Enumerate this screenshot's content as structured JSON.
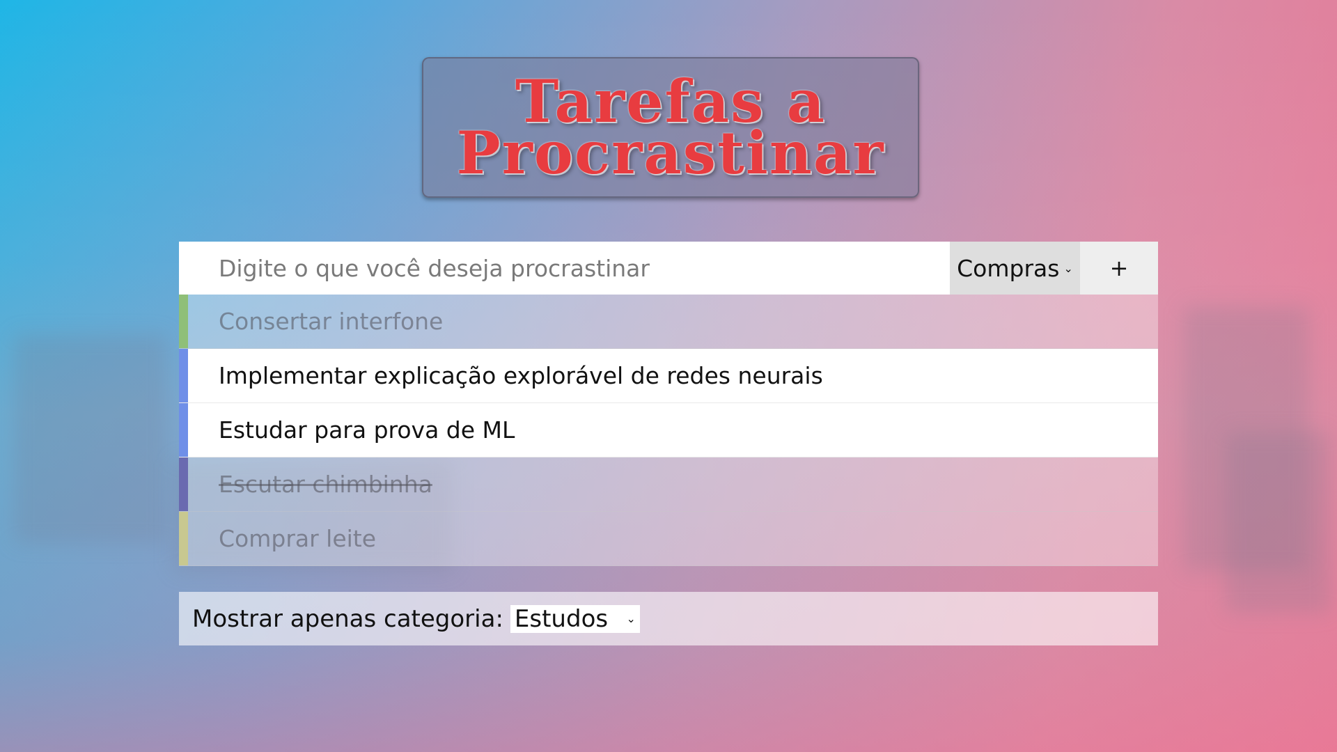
{
  "header": {
    "title_line1": "Tarefas a",
    "title_line2": "Procrastinar"
  },
  "entry": {
    "placeholder": "Digite o que você deseja procrastinar",
    "category_selected": "Compras",
    "add_label": "+"
  },
  "tasks": [
    {
      "text": "Consertar interfone",
      "color": "#8fbf78",
      "state": "dimmed"
    },
    {
      "text": "Implementar explicação explorável de redes neurais",
      "color": "#6f8fe8",
      "state": "active"
    },
    {
      "text": "Estudar para prova de ML",
      "color": "#6f8fe8",
      "state": "active"
    },
    {
      "text": "Escutar chimbinha",
      "color": "#6a6ab0",
      "state": "dimmed-struck"
    },
    {
      "text": "Comprar leite",
      "color": "#c8c890",
      "state": "dimmed"
    }
  ],
  "filter": {
    "label": "Mostrar apenas categoria:",
    "selected": "Estudos"
  },
  "icons": {
    "dropdown": "chevron-down-icon"
  }
}
